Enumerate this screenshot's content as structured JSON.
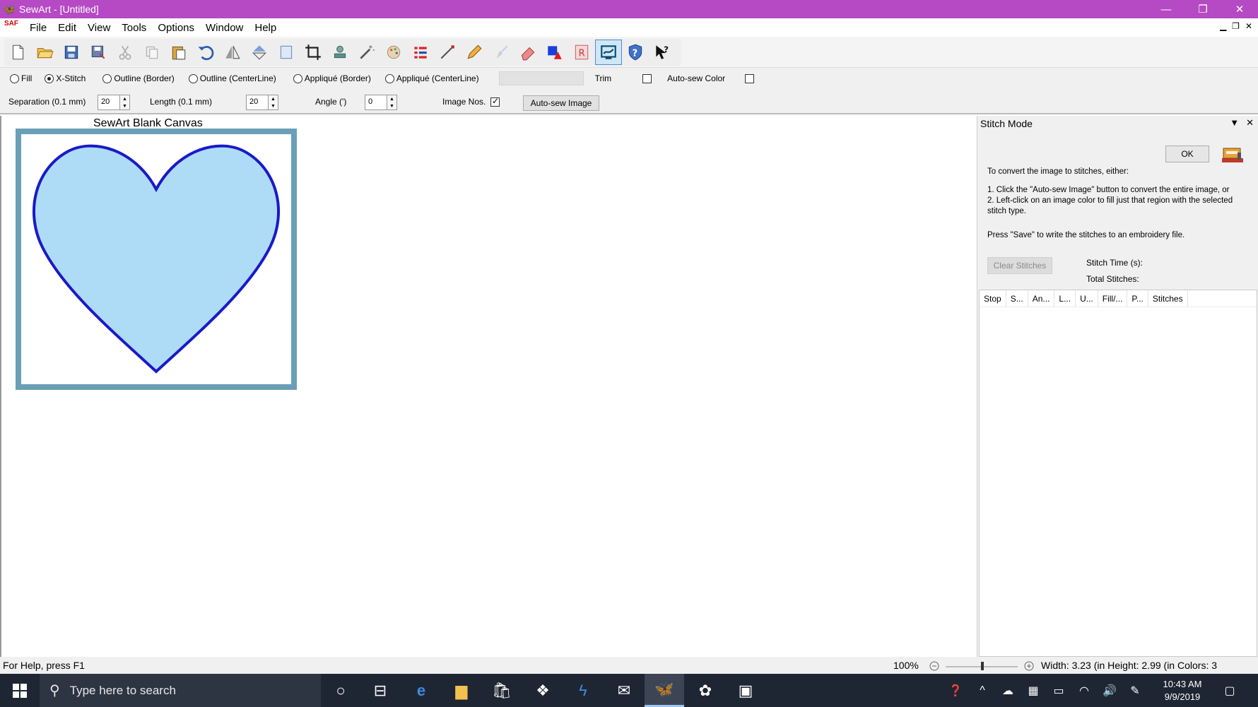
{
  "window": {
    "title": "SewArt - [Untitled]",
    "minimize": "—",
    "restore": "❐",
    "close": "✕"
  },
  "menu": {
    "items": [
      "File",
      "Edit",
      "View",
      "Tools",
      "Options",
      "Window",
      "Help"
    ],
    "doc_icon_text": "SAF"
  },
  "stitch_types": {
    "options": [
      "Fill",
      "X-Stitch",
      "Outline (Border)",
      "Outline (CenterLine)",
      "Appliqué (Border)",
      "Appliqué (CenterLine)"
    ],
    "selected": "X-Stitch",
    "trim_label": "Trim",
    "autosew_color_label": "Auto-sew Color"
  },
  "params": {
    "separation_label": "Separation (0.1 mm)",
    "separation_value": "20",
    "length_label": "Length (0.1 mm)",
    "length_value": "20",
    "angle_label": "Angle (')",
    "angle_value": "0",
    "image_nos_label": "Image Nos.",
    "autosew_button": "Auto-sew Image"
  },
  "canvas": {
    "title": "SewArt Blank Canvas",
    "heart_fill": "#aedcf6",
    "heart_stroke": "#1a1ac8",
    "frame_color": "#6a9fb8"
  },
  "panel": {
    "title": "Stitch Mode",
    "ok_button": "OK",
    "intro": "To convert the image to stitches, either:",
    "step1": "1. Click the \"Auto-sew Image\" button to convert the entire image, or",
    "step2": "2. Left-click on an image color to fill just that region with the selected stitch type.",
    "save_note": "Press \"Save\" to write the stitches to an embroidery file.",
    "clear_button": "Clear Stitches",
    "stitch_time_label": "Stitch Time (s):",
    "total_stitches_label": "Total Stitches:",
    "columns": [
      "Stop",
      "S...",
      "An...",
      "L...",
      "U...",
      "Fill/...",
      "P...",
      "Stitches"
    ]
  },
  "status": {
    "help": "For Help, press F1",
    "zoom": "100%",
    "dims": "Width: 3.23 (in Height: 2.99 (in Colors: 3"
  },
  "taskbar": {
    "search_placeholder": "Type here to search",
    "time": "10:43 AM",
    "date": "9/9/2019"
  }
}
